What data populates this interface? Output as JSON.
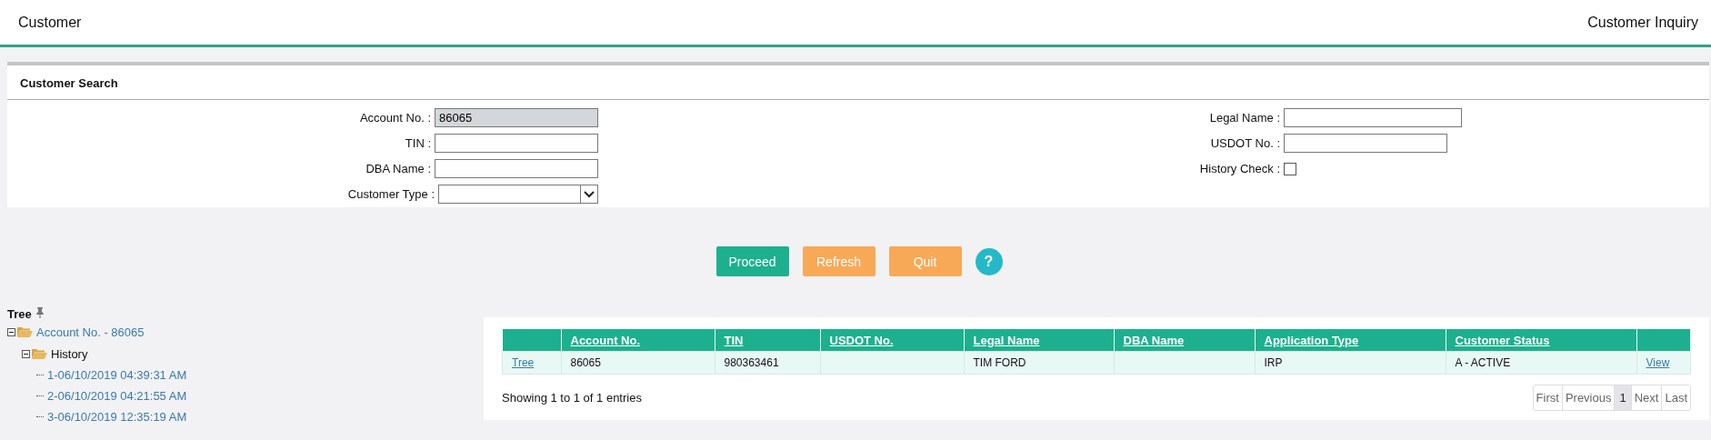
{
  "header": {
    "title": "Customer",
    "page_title": "Customer Inquiry"
  },
  "search_panel": {
    "title": "Customer Search",
    "left_fields": [
      {
        "label": "Account No. :",
        "kind": "text",
        "value": "86065",
        "disabled": true
      },
      {
        "label": "TIN :",
        "kind": "text",
        "disabled": false
      },
      {
        "label": "DBA Name :",
        "kind": "text",
        "disabled": false
      },
      {
        "label": "Customer Type :",
        "kind": "select",
        "disabled": false
      }
    ],
    "right_fields": [
      {
        "label": "Legal Name :",
        "kind": "text",
        "disabled": false
      },
      {
        "label": "USDOT No. :",
        "kind": "text",
        "disabled": false
      },
      {
        "label": "History Check :",
        "kind": "checkbox",
        "checked": false
      }
    ]
  },
  "buttons": [
    {
      "label": "Proceed",
      "kind": "primary"
    },
    {
      "label": "Refresh",
      "kind": "secondary"
    },
    {
      "label": "Quit",
      "kind": "secondary"
    },
    {
      "kind": "help",
      "label": "?"
    }
  ],
  "tree": {
    "title": "Tree",
    "nodes": [
      {
        "label": "Account No. - 86065",
        "link": true,
        "expanded": true,
        "children": [
          {
            "label": "History",
            "link": false,
            "expanded": true,
            "children": [
              {
                "label": "1-06/10/2019 04:39:31 AM",
                "link": true
              },
              {
                "label": "2-06/10/2019 04:21:55 AM",
                "link": true
              },
              {
                "label": "3-06/10/2019 12:35:19 AM",
                "link": true
              }
            ]
          }
        ]
      }
    ]
  },
  "table": {
    "columns": [
      {},
      {
        "label": "Account No."
      },
      {
        "label": "TIN"
      },
      {
        "label": "USDOT No."
      },
      {
        "label": "Legal Name"
      },
      {
        "label": "DBA Name"
      },
      {
        "label": "Application Type"
      },
      {
        "label": "Customer Status"
      },
      {}
    ],
    "rows": [
      {
        "cells": [
          {
            "kind": "link",
            "text": "Tree"
          },
          {
            "kind": "text",
            "text": "86065"
          },
          {
            "kind": "text",
            "text": "980363461"
          },
          {
            "kind": "empty"
          },
          {
            "kind": "text",
            "text": "TIM FORD"
          },
          {
            "kind": "empty"
          },
          {
            "kind": "text",
            "text": "IRP"
          },
          {
            "kind": "text",
            "text": "A - ACTIVE"
          },
          {
            "kind": "link",
            "text": "View"
          }
        ]
      }
    ],
    "info": "Showing 1 to 1 of 1 entries",
    "pagination": [
      {
        "label": "First",
        "selected": false
      },
      {
        "label": "Previous",
        "selected": false
      },
      {
        "label": "1",
        "selected": true
      },
      {
        "label": "Next",
        "selected": false
      },
      {
        "label": "Last",
        "selected": false
      }
    ]
  }
}
